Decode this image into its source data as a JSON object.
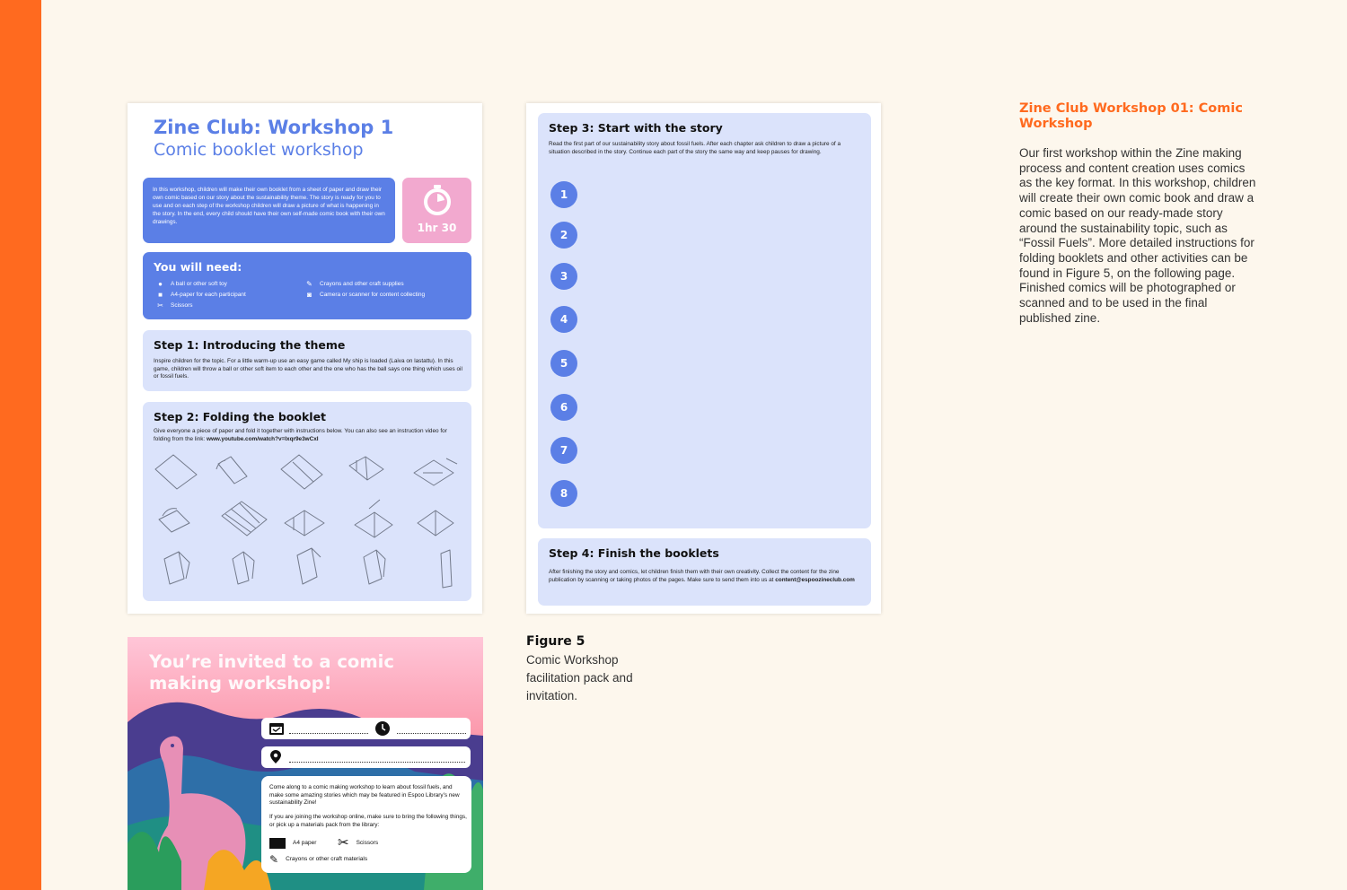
{
  "page1": {
    "title": "Zine Club: Workshop 1",
    "subtitle": "Comic booklet workshop",
    "intro": "In this workshop, children will make their own booklet from a sheet of paper and draw their own comic based on our story about the sustainability theme. The story is ready for you to use and on each step of the workshop children will draw a picture of what is happening in the story. In the end, every child should have their own self-made comic book with their own drawings.",
    "duration": "1hr 30",
    "need_title": "You will need:",
    "need_items": [
      {
        "icon": "ball-icon",
        "label": "A ball or other soft toy"
      },
      {
        "icon": "paper-icon",
        "label": "A4-paper for each participant"
      },
      {
        "icon": "scissors-icon",
        "label": "Scissors"
      },
      {
        "icon": "pencil-icon",
        "label": "Crayons and other craft supplies"
      },
      {
        "icon": "camera-icon",
        "label": "Camera or scanner for content collecting"
      }
    ],
    "step1": {
      "title": "Step 1: Introducing the theme",
      "text": "Inspire children for the topic. For a little warm-up use an easy game called My ship is loaded (Laiva on lastattu). In this game, children will throw a ball or other soft item to each other and the one who has the ball says one thing which uses oil or fossil fuels."
    },
    "step2": {
      "title": "Step 2: Folding the booklet",
      "text": "Give everyone a piece of paper and fold it together with instructions below. You can also see an instruction video for folding from the link:",
      "link": "www.youtube.com/watch?v=Ixqr9e3wCxI"
    }
  },
  "page2": {
    "step3": {
      "title": "Step 3: Start with the story",
      "text": "Read the first part of our sustainability story about fossil fuels. After each chapter ask children to draw a picture of a situation described in the story. Continue each part of the story the same way and keep pauses for drawing.",
      "numbers": [
        "1",
        "2",
        "3",
        "4",
        "5",
        "6",
        "7",
        "8"
      ]
    },
    "step4": {
      "title": "Step 4: Finish the booklets",
      "text": "After finishing the story and comics, let children finish them with their own creativity. Collect the content for the zine publication by scanning or taking photos of the pages. Make sure to send them into us at",
      "email": "content@espoozineclub.com"
    }
  },
  "invite": {
    "title": "You’re invited to a comic making workshop!",
    "para1": "Come along to a comic making workshop to learn about fossil fuels, and make some amazing stories which may be featured in Espoo Library’s new sustainability Zine!",
    "para2": "If you are joining the workshop online, make sure to bring the following things, or pick up a materials pack from the library:",
    "materials": [
      {
        "icon": "paper-icon",
        "label": "A4 paper"
      },
      {
        "icon": "scissors-icon",
        "label": "Scissors"
      },
      {
        "icon": "pencil-icon",
        "label": "Crayons or other craft materials"
      }
    ]
  },
  "figure": {
    "label": "Figure 5",
    "caption": "Comic Workshop facilitation pack and invitation."
  },
  "side": {
    "title": "Zine Club Workshop 01: Comic Workshop",
    "body": "Our first workshop within the Zine making process and content creation uses comics as the key format. In this workshop, children will create their own comic book and draw a comic based on our ready-made story around the sustainability topic, such as “Fossil Fuels”. More detailed instructions for folding booklets and other activities can be found in Figure 5, on the following page. Finished comics will be photographed or scanned and to be used in the final published zine."
  },
  "colors": {
    "accent": "#ff6a1f",
    "blue": "#5b7fe6",
    "light_blue": "#dbe3fb",
    "pink": "#f2a9cf"
  }
}
